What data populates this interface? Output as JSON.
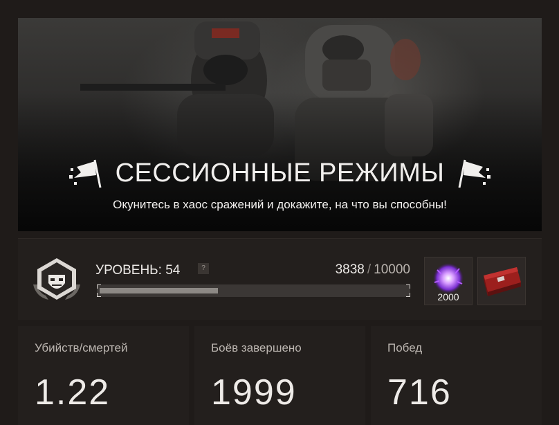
{
  "banner": {
    "title": "СЕССИОННЫЕ РЕЖИМЫ",
    "subtitle": "Окунитесь в хаос сражений и докажите, на что вы способны!"
  },
  "level": {
    "label": "УРОВЕНЬ: 54",
    "help": "?",
    "xp_current": "3838",
    "xp_separator": "/",
    "xp_max": "10000",
    "progress": 0.3838
  },
  "rewards": [
    {
      "icon": "purple-orb-icon",
      "quantity": "2000"
    },
    {
      "icon": "red-crate-icon",
      "quantity": ""
    }
  ],
  "stats": [
    {
      "label": "Убийств/смертей",
      "value": "1.22"
    },
    {
      "label": "Боёв завершено",
      "value": "1999"
    },
    {
      "label": "Побед",
      "value": "716"
    }
  ],
  "colors": {
    "background": "#1f1b19",
    "panel": "#231f1d",
    "progress_fill": "#8d8985",
    "accent_purple": "#b35bff"
  }
}
